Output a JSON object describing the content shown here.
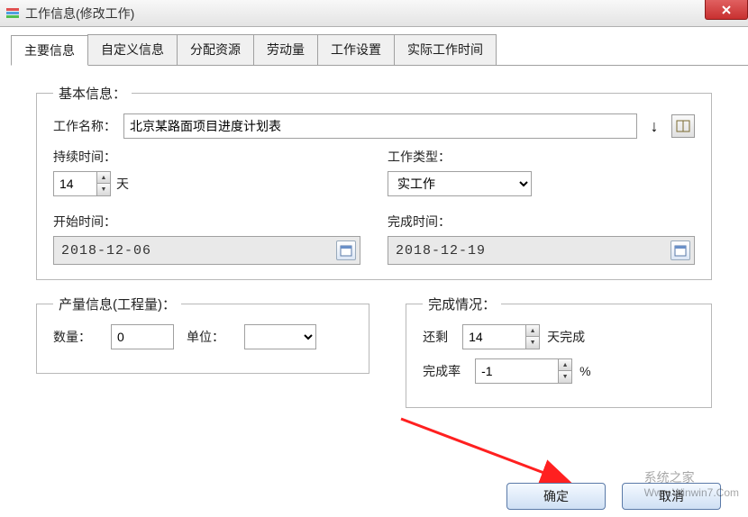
{
  "window": {
    "title": "工作信息(修改工作)"
  },
  "tabs": [
    "主要信息",
    "自定义信息",
    "分配资源",
    "劳动量",
    "工作设置",
    "实际工作时间"
  ],
  "activeTab": 0,
  "basic": {
    "legend": "基本信息：",
    "nameLabel": "工作名称：",
    "nameValue": "北京某路面项目进度计划表",
    "durationLabel": "持续时间：",
    "durationValue": "14",
    "durationUnit": "天",
    "typeLabel": "工作类型：",
    "typeValue": "实工作",
    "startLabel": "开始时间：",
    "startValue": "2018-12-06",
    "endLabel": "完成时间：",
    "endValue": "2018-12-19"
  },
  "output": {
    "legend": "产量信息(工程量)：",
    "qtyLabel": "数量：",
    "qtyValue": "0",
    "unitLabel": "单位："
  },
  "completion": {
    "legend": "完成情况：",
    "remainLabel": "还剩",
    "remainValue": "14",
    "remainSuffix": "天完成",
    "rateLabel": "完成率",
    "rateValue": "-1",
    "rateSuffix": "%"
  },
  "buttons": {
    "ok": "确定",
    "cancel": "取消"
  },
  "watermark": {
    "cn": "系统之家",
    "url": "Www.Winwin7.Com"
  }
}
